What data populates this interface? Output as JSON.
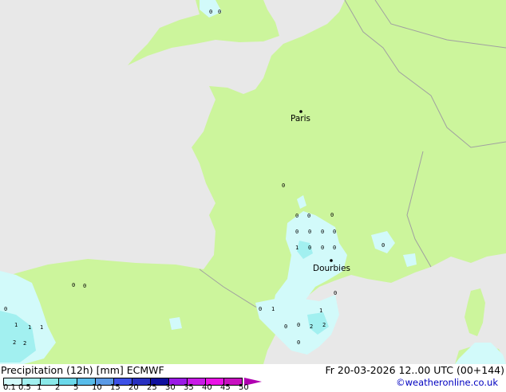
{
  "map": {
    "colors": {
      "sea": "#e8e8e8",
      "land": "#ccf59c",
      "precip_light": "#d2fafa",
      "precip_1": "#a2f0f0",
      "border": "#a0a0a0"
    },
    "cities": [
      {
        "name": "Paris"
      },
      {
        "name": "Dourbies"
      }
    ],
    "values": [
      "0",
      "0",
      "0",
      "0",
      "0",
      "0",
      "0",
      "0",
      "0",
      "0",
      "0",
      "1",
      "0",
      "0",
      "0",
      "0",
      "0",
      "0",
      "1",
      "1",
      "2",
      "2",
      "1",
      "1",
      "2",
      "2",
      "0",
      "0",
      "0",
      "1",
      "0",
      "0"
    ]
  },
  "footer": {
    "title": "Precipitation (12h) [mm] ECMWF",
    "datetime": "Fr 20-03-2026 12..00 UTC (00+144)",
    "credit": "©weatheronline.co.uk",
    "legend": {
      "ticks": [
        "0.1",
        "0.5",
        "1",
        "2",
        "5",
        "10",
        "15",
        "20",
        "25",
        "30",
        "35",
        "40",
        "45",
        "50"
      ],
      "colors": [
        "#d2fafa",
        "#a2f0f0",
        "#8ae8e8",
        "#6ad8ea",
        "#58bcea",
        "#5a9ae6",
        "#3c50e6",
        "#2830c0",
        "#10109e",
        "#9a1ae6",
        "#c81ae6",
        "#ea12e6",
        "#c810c0"
      ]
    }
  }
}
